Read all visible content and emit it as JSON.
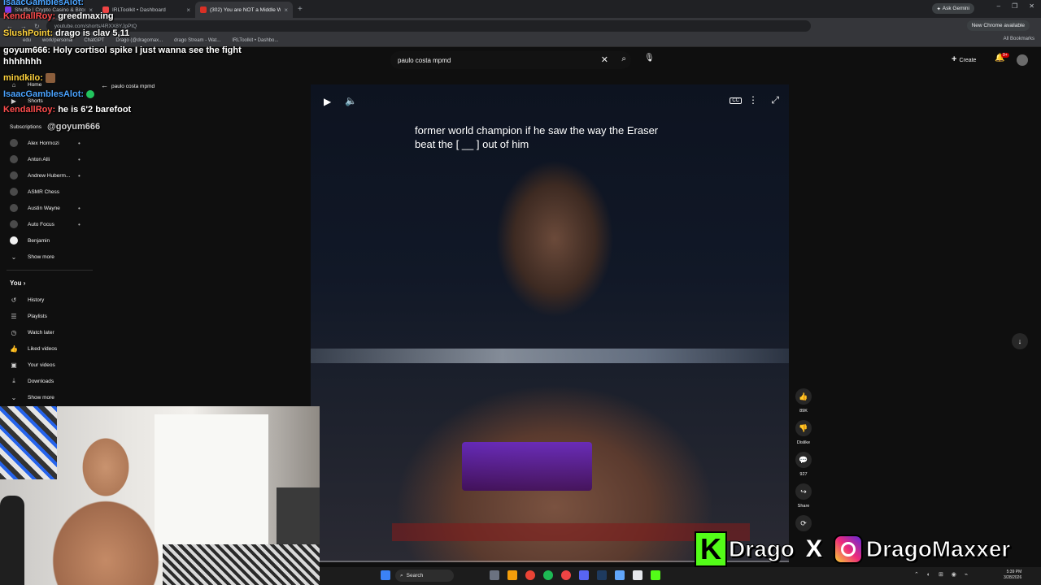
{
  "browser": {
    "tabs": [
      {
        "label": "Shuffle | Crypto Casino & Bitco",
        "active": false
      },
      {
        "label": "IRLToolkit • Dashboard",
        "active": false
      },
      {
        "label": "(302) You are NOT a Middle W",
        "active": true
      }
    ],
    "new_tab": "+",
    "ask_gemini": "Ask Gemini",
    "url": "youtube.com/shorts/4RXX8YJpPtQ",
    "chrome_available": "New Chrome available",
    "bookmarks": [
      "edu",
      "work/personal",
      "ChatGPT",
      "Drago (@dragomax...",
      "drago Stream - Wat...",
      "IRLToolkit • Dashbo..."
    ],
    "all_bookmarks": "All Bookmarks"
  },
  "youtube": {
    "search_value": "paulo costa mpmd",
    "create_label": "Create",
    "notif_badge": "9+",
    "back_label": "paulo costa mpmd",
    "sidebar": {
      "home": "Home",
      "shorts": "Shorts",
      "subscriptions": "Subscriptions",
      "channels": [
        "Alex Hormozi",
        "Anton Alli",
        "Andrew Huberm...",
        "ASMR Chess",
        "Austin Wayne",
        "Auto Focus",
        "Benjamin"
      ],
      "show_more_1": "Show more",
      "you_header": "You",
      "you_items": [
        "History",
        "Playlists",
        "Watch later",
        "Liked videos",
        "Your videos",
        "Downloads"
      ],
      "show_more_2": "Show more"
    },
    "video": {
      "caption": "former world champion if he saw the way the Eraser beat the [ __ ] out of him",
      "progress": 0.0
    },
    "actions": {
      "likes": "89K",
      "dislike": "Dislike",
      "comments": "927",
      "share": "Share"
    }
  },
  "chat": [
    {
      "user": "IsaacGamblesAlot:",
      "text": "",
      "color": "#4aa3ff"
    },
    {
      "user": "KendallRoy:",
      "text": "greedmaxing",
      "color": "#ff4d4d"
    },
    {
      "user": "SlushPoint:",
      "text": "drago is clav 5,11",
      "color": "#ffd33d"
    },
    {
      "user": "goyum666:",
      "text": "Holy cortisol spike I just wanna see the fight hhhhhhh",
      "color": "#ffffff"
    },
    {
      "user": "mindkilo:",
      "text": "",
      "color": "#ffd33d"
    },
    {
      "user": "IsaacGamblesAlot:",
      "text": "",
      "color": "#4aa3ff"
    },
    {
      "user": "KendallRoy:",
      "text": "he is 6'2 barefoot",
      "color": "#ff4d4d"
    },
    {
      "user": "",
      "text": "@goyum666",
      "color": "#cfcfcf"
    }
  ],
  "taskbar": {
    "search": "Search",
    "time": "5:39 PM",
    "date": "3/28/2026"
  },
  "brand": {
    "kick_letter": "K",
    "kick_name": "Drago",
    "separator": "X",
    "ig_name": "DragoMaxxer"
  }
}
